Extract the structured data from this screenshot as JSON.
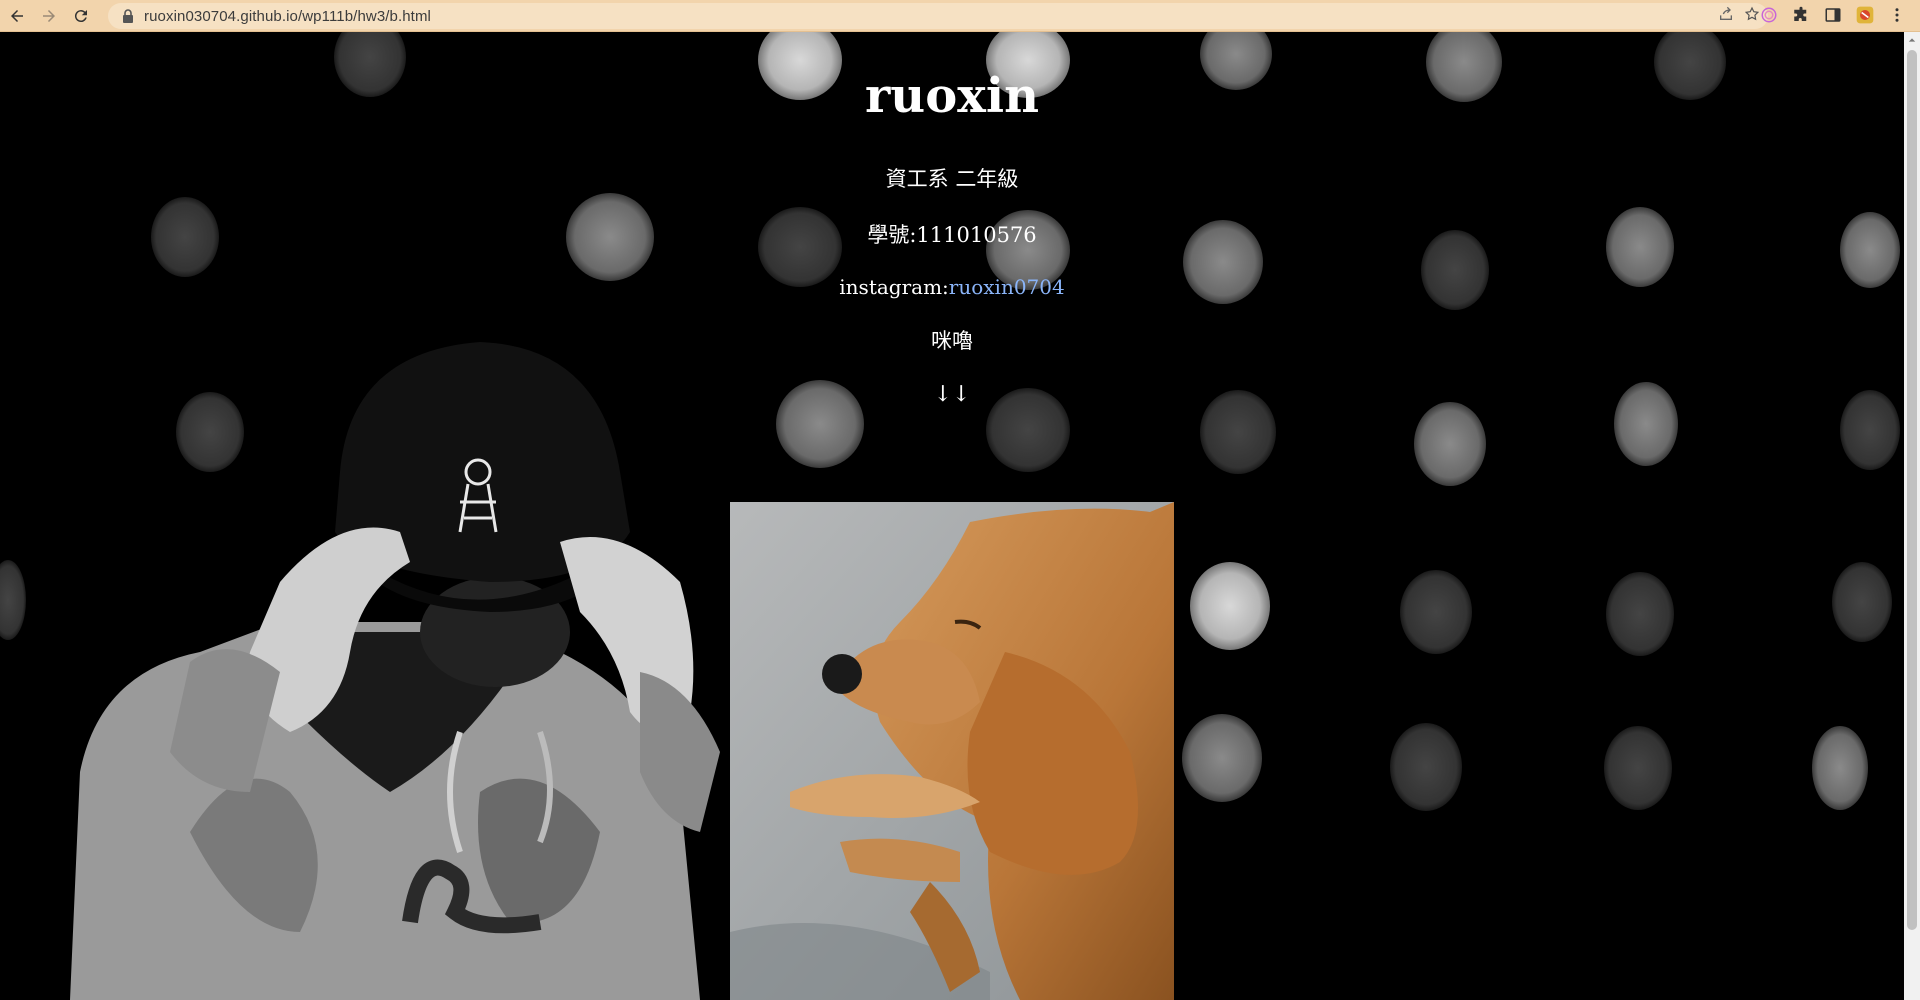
{
  "browser": {
    "url": "ruoxin030704.github.io/wp111b/hw3/b.html",
    "icons": {
      "back": "back-arrow-icon",
      "forward": "forward-arrow-icon",
      "reload": "reload-icon",
      "lock": "lock-icon",
      "share": "share-icon",
      "bookmark": "star-icon",
      "extension1": "spiral-extension-icon",
      "extensions": "puzzle-icon",
      "sidepanel": "side-panel-icon",
      "profile": "profile-avatar-icon",
      "menu": "kebab-menu-icon"
    },
    "toolbar_color": "#f2d4ac"
  },
  "page": {
    "title": "ruoxin",
    "department": "資工系 二年級",
    "student_id": "學號:111010576",
    "instagram_label": "instagram:",
    "instagram_handle": "ruoxin0704",
    "dog_name": "咪嚕",
    "arrows": "↓↓",
    "link_color": "#8ab4f8",
    "background_color": "#000000",
    "text_color": "#ffffff"
  }
}
